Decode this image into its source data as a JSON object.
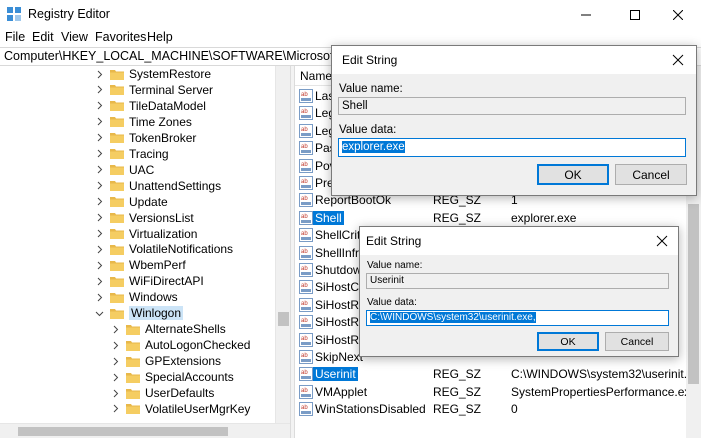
{
  "window": {
    "title": "Registry Editor"
  },
  "menu": [
    "File",
    "Edit",
    "View",
    "Favorites",
    "Help"
  ],
  "address": "Computer\\HKEY_LOCAL_MACHINE\\SOFTWARE\\Microsoft\\Windows",
  "tree": {
    "items": [
      {
        "label": "SystemRestore",
        "level": 1
      },
      {
        "label": "Terminal Server",
        "level": 1
      },
      {
        "label": "TileDataModel",
        "level": 1
      },
      {
        "label": "Time Zones",
        "level": 1
      },
      {
        "label": "TokenBroker",
        "level": 1
      },
      {
        "label": "Tracing",
        "level": 1
      },
      {
        "label": "UAC",
        "level": 1
      },
      {
        "label": "UnattendSettings",
        "level": 1
      },
      {
        "label": "Update",
        "level": 1
      },
      {
        "label": "VersionsList",
        "level": 1
      },
      {
        "label": "Virtualization",
        "level": 1
      },
      {
        "label": "VolatileNotifications",
        "level": 1
      },
      {
        "label": "WbemPerf",
        "level": 1
      },
      {
        "label": "WiFiDirectAPI",
        "level": 1
      },
      {
        "label": "Windows",
        "level": 1
      },
      {
        "label": "Winlogon",
        "level": 1,
        "expanded": true,
        "selected": true
      },
      {
        "label": "AlternateShells",
        "level": 2
      },
      {
        "label": "AutoLogonChecked",
        "level": 2
      },
      {
        "label": "GPExtensions",
        "level": 2
      },
      {
        "label": "SpecialAccounts",
        "level": 2
      },
      {
        "label": "UserDefaults",
        "level": 2
      },
      {
        "label": "VolatileUserMgrKey",
        "level": 2
      }
    ]
  },
  "list": {
    "col_name": "Name",
    "rows": [
      {
        "name": "Las",
        "type": "",
        "data": ""
      },
      {
        "name": "Leg",
        "type": "",
        "data": ""
      },
      {
        "name": "Leg",
        "type": "",
        "data": ""
      },
      {
        "name": "Pas",
        "type": "",
        "data": ""
      },
      {
        "name": "Pov",
        "type": "",
        "data": ""
      },
      {
        "name": "Pre",
        "type": "",
        "data": ""
      },
      {
        "name": "ReportBootOk",
        "type": "REG_SZ",
        "data": "1"
      },
      {
        "name": "Shell",
        "type": "REG_SZ",
        "data": "explorer.exe",
        "selected": true
      },
      {
        "name": "ShellCriti",
        "type": "",
        "data": ""
      },
      {
        "name": "ShellInfra",
        "type": "",
        "data": ""
      },
      {
        "name": "Shutdowr",
        "type": "",
        "data": ""
      },
      {
        "name": "SiHostCri",
        "type": "",
        "data": ""
      },
      {
        "name": "SiHostRe",
        "type": "",
        "data": ""
      },
      {
        "name": "SiHostRe",
        "type": "",
        "data": ""
      },
      {
        "name": "SiHostRe",
        "type": "",
        "data": ""
      },
      {
        "name": "SkipNext",
        "type": "",
        "data": ""
      },
      {
        "name": "Userinit",
        "type": "REG_SZ",
        "data": "C:\\WINDOWS\\system32\\userinit.exe,",
        "selected": true
      },
      {
        "name": "VMApplet",
        "type": "REG_SZ",
        "data": "SystemPropertiesPerformance.exe /p"
      },
      {
        "name": "WinStationsDisabled",
        "type": "REG_SZ",
        "data": "0"
      }
    ]
  },
  "dialog1": {
    "title": "Edit String",
    "value_name_label": "Value name:",
    "value_name": "Shell",
    "value_data_label": "Value data:",
    "value_data": "explorer.exe",
    "ok": "OK",
    "cancel": "Cancel"
  },
  "dialog2": {
    "title": "Edit String",
    "value_name_label": "Value name:",
    "value_name": "Userinit",
    "value_data_label": "Value data:",
    "value_data": "C:\\WINDOWS\\system32\\userinit.exe,",
    "ok": "OK",
    "cancel": "Cancel"
  },
  "colors": {
    "selection": "#0078d7",
    "tree_selection": "#cce4f7",
    "folder": "#e8b84a"
  }
}
